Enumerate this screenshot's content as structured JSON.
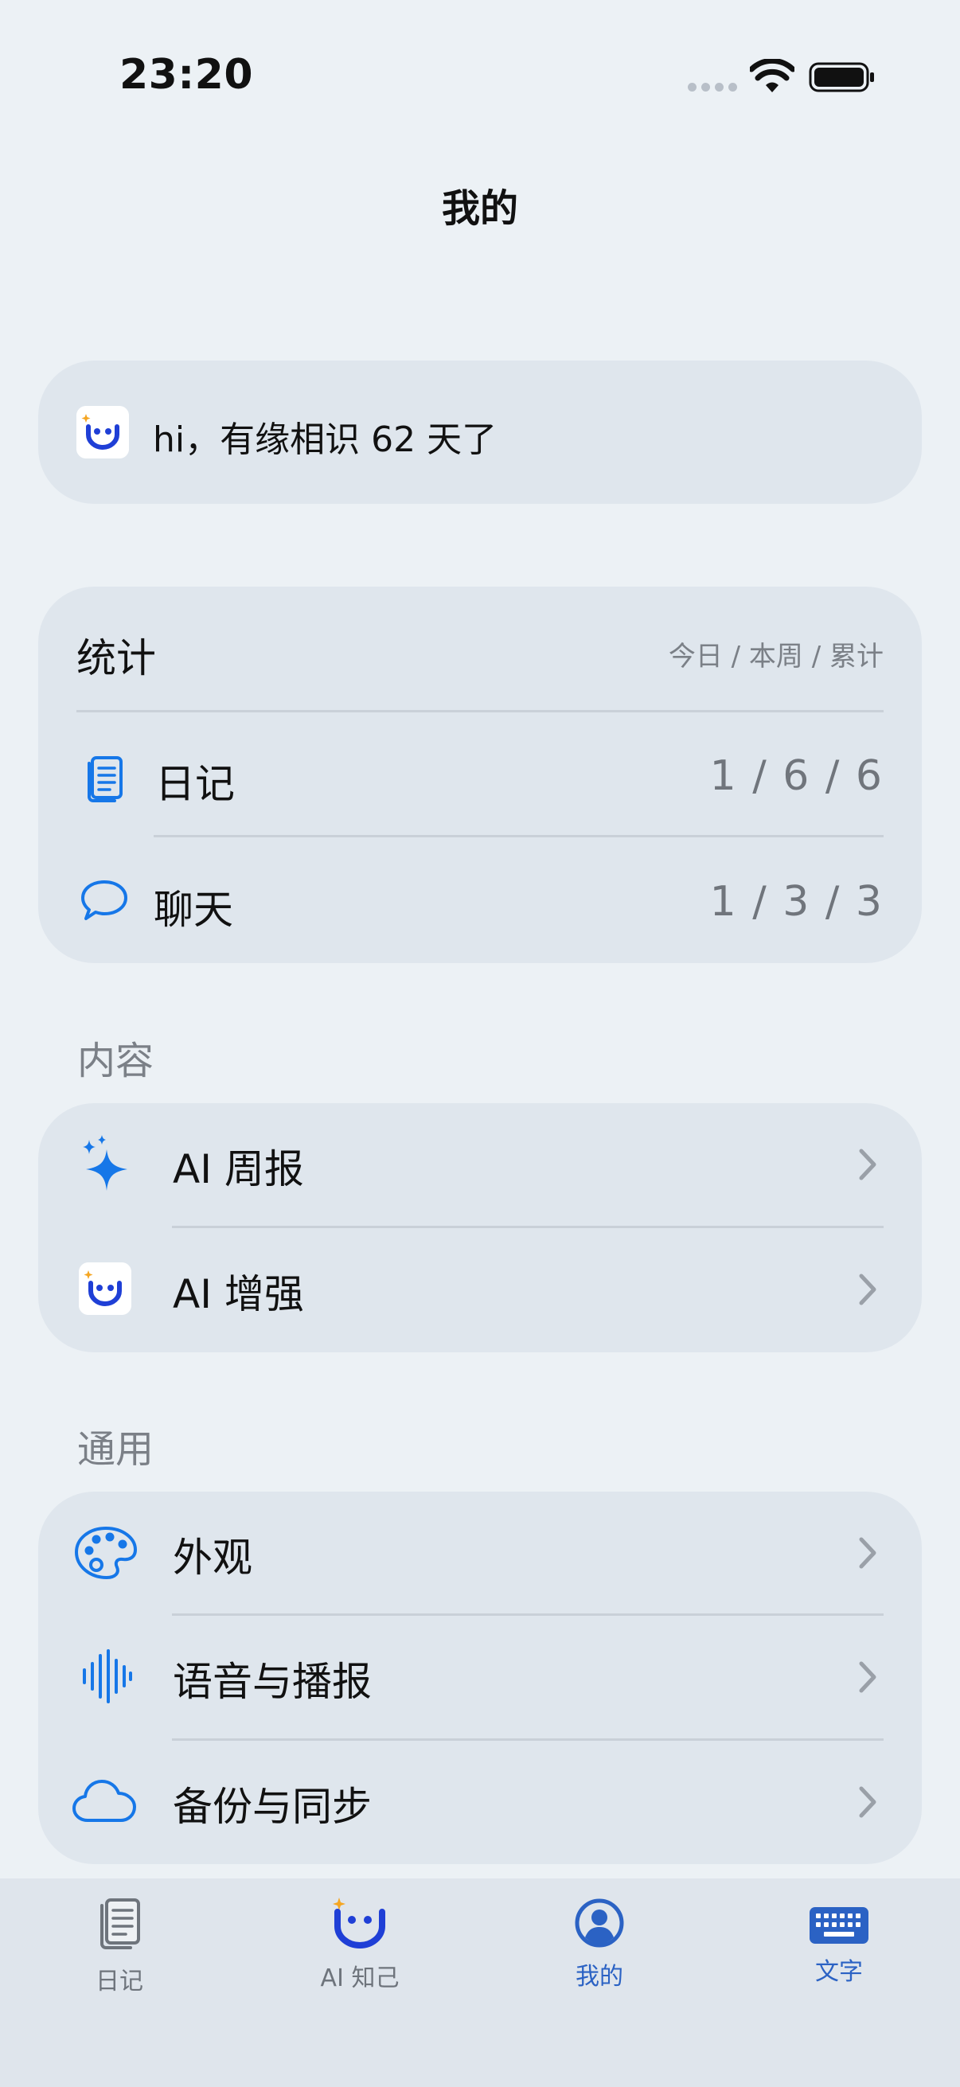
{
  "status_bar": {
    "time": "23:20"
  },
  "nav": {
    "title": "我的"
  },
  "greeting": {
    "text": "hi，有缘相识 62 天了"
  },
  "stats": {
    "title": "统计",
    "hint": "今日 / 本周 / 累计",
    "rows": [
      {
        "label": "日记",
        "value": "1 / 6 / 6",
        "icon": "diary-icon"
      },
      {
        "label": "聊天",
        "value": "1 / 3 / 3",
        "icon": "chat-bubble-icon"
      }
    ]
  },
  "content_section": {
    "title": "内容",
    "items": [
      {
        "label": "AI 周报",
        "icon": "sparkle-icon"
      },
      {
        "label": "AI 增强",
        "icon": "app-logo-icon"
      }
    ]
  },
  "general_section": {
    "title": "通用",
    "items": [
      {
        "label": "外观",
        "icon": "palette-icon"
      },
      {
        "label": "语音与播报",
        "icon": "waveform-icon"
      },
      {
        "label": "备份与同步",
        "icon": "cloud-icon"
      }
    ]
  },
  "tabbar": {
    "tabs": [
      {
        "label": "日记",
        "icon": "diary-tab-icon",
        "color": "#6e747c"
      },
      {
        "label": "AI 知己",
        "icon": "app-logo-icon",
        "color": "#6e747c"
      },
      {
        "label": "我的",
        "icon": "person-circle-icon",
        "color": "#2b62c4"
      },
      {
        "label": "文字",
        "icon": "keyboard-icon",
        "color": "#2b62c4"
      }
    ]
  },
  "colors": {
    "accent": "#1677e8",
    "logo_blue": "#1f3fd6",
    "logo_star": "#f5a623"
  }
}
